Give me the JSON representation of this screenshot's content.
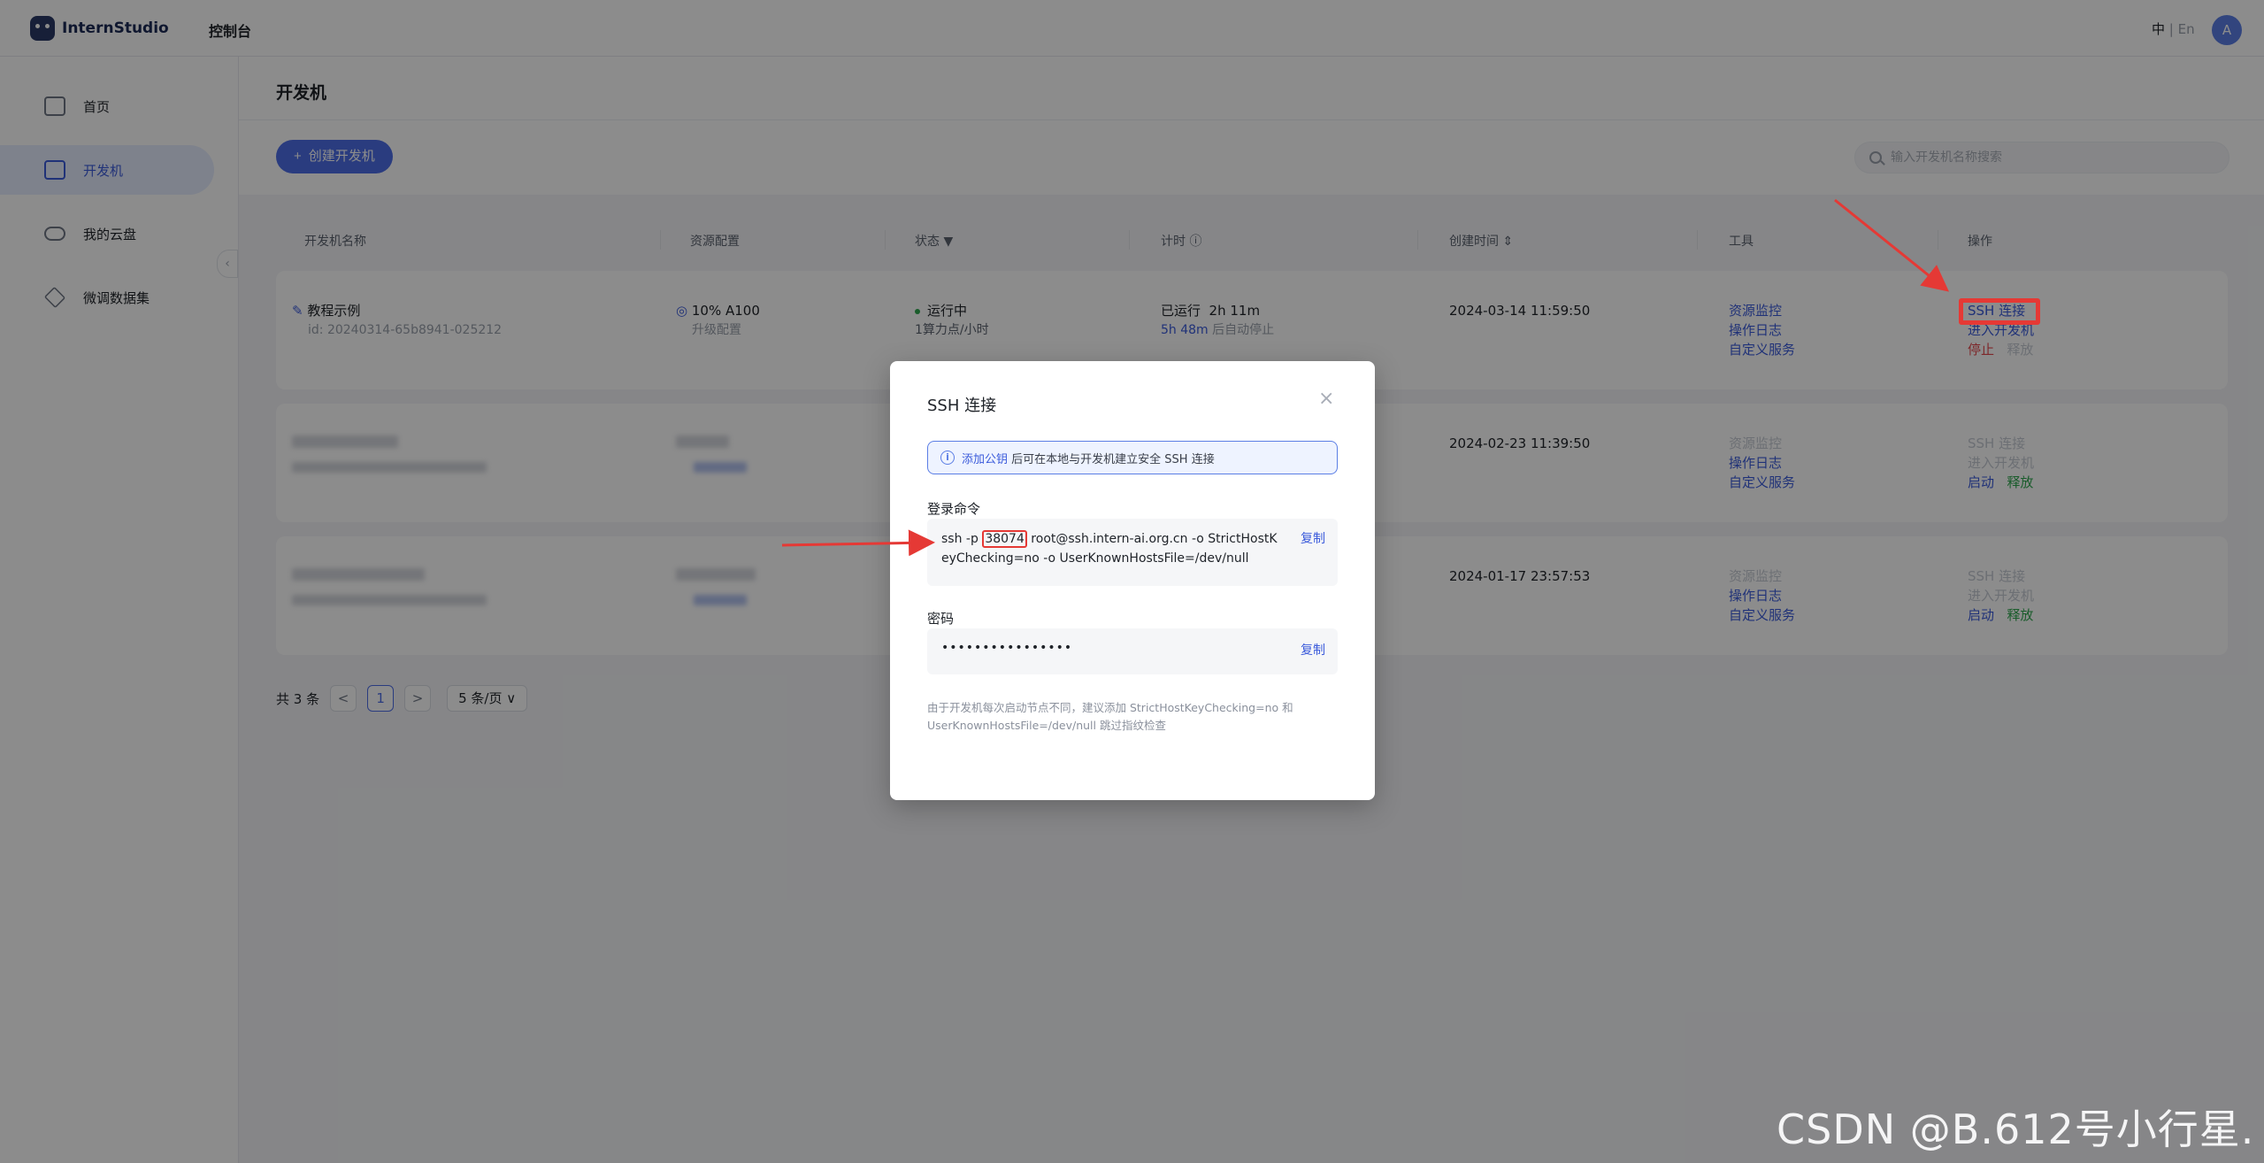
{
  "header": {
    "logo_text": "InternStudio",
    "console_label": "控制台",
    "lang_zh": "中",
    "lang_sep": " | ",
    "lang_en": "En",
    "avatar_letter": "A"
  },
  "sidebar": {
    "items": [
      {
        "label": "首页",
        "icon": "home-icon"
      },
      {
        "label": "开发机",
        "icon": "terminal-icon",
        "active": true
      },
      {
        "label": "我的云盘",
        "icon": "cloud-icon"
      },
      {
        "label": "微调数据集",
        "icon": "layers-icon"
      }
    ],
    "collapse_glyph": "‹"
  },
  "page": {
    "title": "开发机",
    "create_button": "创建开发机",
    "search_placeholder": "输入开发机名称搜索"
  },
  "table": {
    "columns": [
      "开发机名称",
      "资源配置",
      "状态",
      "计时",
      "创建时间",
      "工具",
      "操作"
    ],
    "rows": [
      {
        "name": "教程示例",
        "id": "id: 20240314-65b8941-025212",
        "resource": "10% A100",
        "resource_sub": "升级配置",
        "status": "运行中",
        "status_sub": "1算力点/小时",
        "timer": "已运行  2h 11m",
        "timer_sub_time": "5h 48m",
        "timer_sub_text": " 后自动停止",
        "created": "2024-03-14 11:59:50",
        "tools": [
          "资源监控",
          "操作日志",
          "自定义服务"
        ],
        "ops": [
          "SSH 连接",
          "进入开发机",
          "停止",
          "释放"
        ]
      },
      {
        "created": "2024-02-23 11:39:50",
        "tools": [
          "资源监控",
          "操作日志",
          "自定义服务"
        ],
        "ops": [
          "SSH 连接",
          "进入开发机",
          "启动",
          "释放"
        ]
      },
      {
        "created": "2024-01-17 23:57:53",
        "tools": [
          "资源监控",
          "操作日志",
          "自定义服务"
        ],
        "ops": [
          "SSH 连接",
          "进入开发机",
          "启动",
          "释放"
        ]
      }
    ]
  },
  "pagination": {
    "total": "共 3 条",
    "prev": "<",
    "current": "1",
    "next": ">",
    "page_size": "5 条/页 ∨"
  },
  "modal": {
    "title": "SSH 连接",
    "close": "×",
    "info_icon": "i",
    "info_link": "添加公钥",
    "info_text": "后可在本地与开发机建立安全 SSH 连接",
    "login_label": "登录命令",
    "cmd_prefix": "ssh -p ",
    "cmd_port": "38074",
    "cmd_suffix": " root@ssh.intern-ai.org.cn -o StrictHostKeyChecking=no -o UserKnownHostsFile=/dev/null",
    "copy": "复制",
    "password_label": "密码",
    "password_mask": "••••••••••••••••",
    "note": "由于开发机每次启动节点不同，建议添加 StrictHostKeyChecking=no 和 UserKnownHostsFile=/dev/null 跳过指纹检查"
  },
  "watermark": "CSDN @B.612号小行星.",
  "colors": {
    "accent": "#4e6ee8",
    "link": "#3b5bdb",
    "annotation": "#e53935",
    "running": "#2fa84f",
    "stop": "#e5484d"
  }
}
